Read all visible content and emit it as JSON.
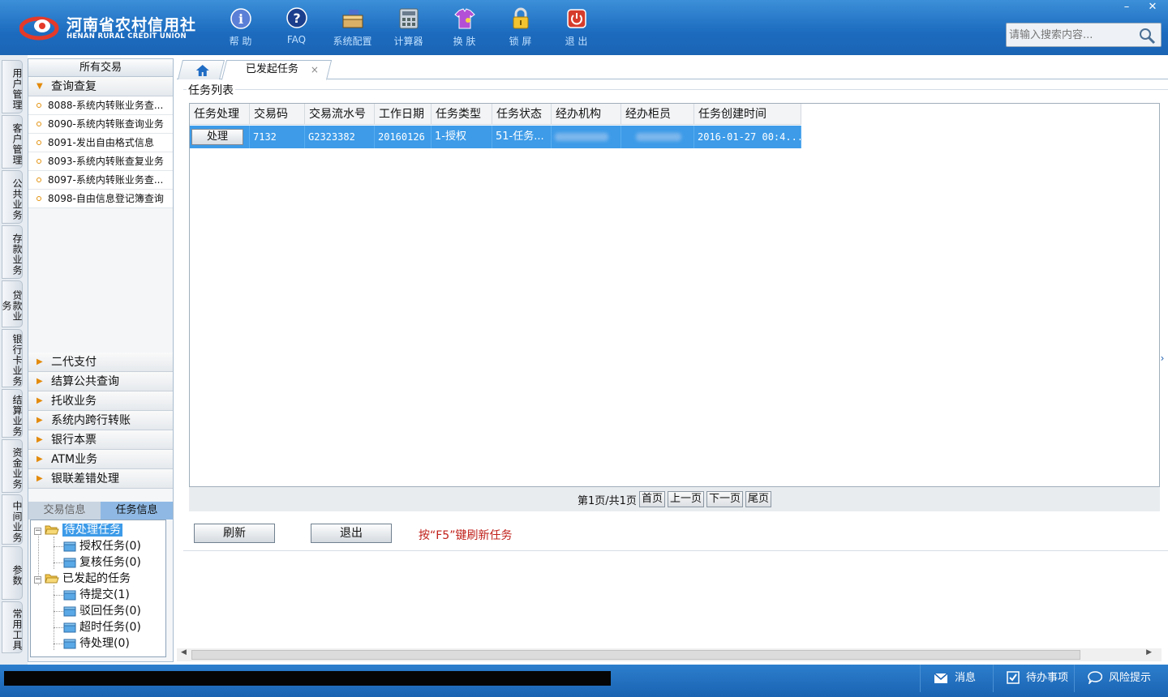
{
  "header": {
    "logo_cn": "河南省农村信用社",
    "logo_en": "HENAN RURAL CREDIT UNION",
    "toolbar": [
      {
        "label": "帮 助",
        "icon": "help-icon"
      },
      {
        "label": "FAQ",
        "icon": "faq-icon"
      },
      {
        "label": "系统配置",
        "icon": "toolbox-icon"
      },
      {
        "label": "计算器",
        "icon": "calculator-icon"
      },
      {
        "label": "换 肤",
        "icon": "skin-icon"
      },
      {
        "label": "锁 屏",
        "icon": "lock-icon"
      },
      {
        "label": "退 出",
        "icon": "power-icon"
      }
    ],
    "search_placeholder": "请输入搜索内容...",
    "minimize": "–",
    "close": "✕"
  },
  "vnav": [
    "用户管理",
    "客户管理",
    "公共业务",
    "存款业务",
    "贷款业务",
    "银行卡业务",
    "结算业务",
    "资金业务",
    "中间业务",
    "参数",
    "常用工具"
  ],
  "sidebar": {
    "head": "所有交易",
    "open_group": "查询查复",
    "items": [
      "8088-系统内转账业务查...",
      "8090-系统内转账查询业务",
      "8091-发出自由格式信息",
      "8093-系统内转账查复业务",
      "8097-系统内转账业务查...",
      "8098-自由信息登记簿查询"
    ],
    "groups": [
      "二代支付",
      "结算公共查询",
      "托收业务",
      "系统内跨行转账",
      "银行本票",
      "ATM业务",
      "银联差错处理"
    ],
    "subtabs": [
      "交易信息",
      "任务信息"
    ],
    "tree": {
      "pending": "待处理任务",
      "pending_children": [
        "授权任务(0)",
        "复核任务(0)"
      ],
      "initiated": "已发起的任务",
      "initiated_children": [
        "待提交(1)",
        "驳回任务(0)",
        "超时任务(0)",
        "待处理(0)"
      ]
    }
  },
  "main": {
    "tab_label": "已发起任务",
    "tab_close": "×",
    "section_title": "任务列表",
    "columns": [
      "任务处理",
      "交易码",
      "交易流水号",
      "工作日期",
      "任务类型",
      "任务状态",
      "经办机构",
      "经办柜员",
      "任务创建时间"
    ],
    "rows": [
      {
        "action": "处理",
        "code": "7132",
        "serial": "G2323382",
        "date": "20160126",
        "type": "1-授权",
        "status": "51-任务...",
        "org": "",
        "teller": "",
        "created": "2016-01-27 00:4..."
      }
    ],
    "pager": {
      "info": "第1页/共1页",
      "first": "首页",
      "prev": "上一页",
      "next": "下一页",
      "last": "尾页"
    },
    "refresh": "刷新",
    "exit": "退出",
    "hint": "按“F5”键刷新任务"
  },
  "footer": {
    "message": "消息",
    "todo": "待办事项",
    "risk": "风险提示"
  },
  "colors": {
    "header": "#1c6bbf",
    "selected_row": "#3d9be8",
    "hint": "#c0201a"
  }
}
